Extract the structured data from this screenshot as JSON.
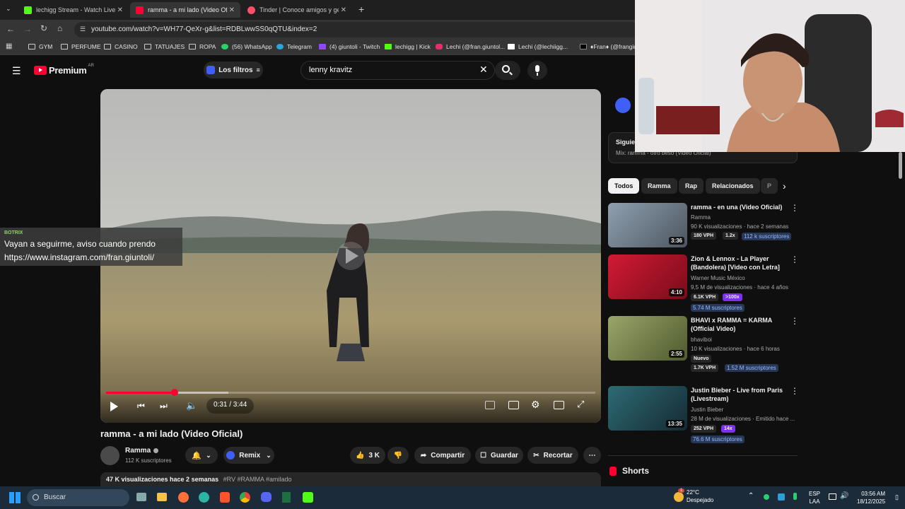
{
  "browser": {
    "tabs": [
      {
        "title": "lechigg Stream - Watch Live on",
        "favicon_color": "#53fc18"
      },
      {
        "title": "ramma - a mi lado (Video Oficial)",
        "favicon_color": "#ff0033"
      },
      {
        "title": "Tinder | Conoce amigos y gente",
        "favicon_color": "#fd5068"
      }
    ],
    "url": "youtube.com/watch?v=WH77-QeXr-g&list=RDBLwwSS0qQTU&index=2",
    "bookmarks": [
      "GYM",
      "PERFUME",
      "CASINO",
      "TATUAJES",
      "ROPA",
      "(56) WhatsApp",
      "Telegram",
      "(4) giuntoli - Twitch",
      "lechigg | Kick",
      "Lechi (@fran.giuntol...",
      "Lechi (@lechiigg...",
      "♦Fran♦ (@frangiu"
    ]
  },
  "youtube": {
    "logo_text": "Premium",
    "region": "AR",
    "filters_label": "Los filtros",
    "search_value": "lenny kravitz"
  },
  "player": {
    "time": "0:31 / 3:44",
    "progress": 0.14,
    "buffered": 0.25
  },
  "overlay": {
    "label": "BOTRIX",
    "line1": "Vayan a seguirme, aviso cuando prendo",
    "line2": "https://www.instagram.com/fran.giuntoli/"
  },
  "video": {
    "title": "ramma - a mi lado (Video Oficial)",
    "channel": "Ramma",
    "subscribers": "112 K suscriptores",
    "remix_label": "Remix",
    "likes": "3 K",
    "share_label": "Compartir",
    "save_label": "Guardar",
    "clip_label": "Recortar",
    "views_line": "47 K visualizaciones  hace 2 semanas",
    "hashtags": "#RV #RAMMA #amilado"
  },
  "sidebar": {
    "next_label": "Siguien",
    "next_sub": "Mix: ramma - otro beso (Video Oficial)",
    "chips": [
      "Todos",
      "Ramma",
      "Rap",
      "Relacionados",
      "P"
    ],
    "recs": [
      {
        "title": "ramma - en una (Video Oficial)",
        "channel": "Ramma",
        "stats": "90 K visualizaciones · hace 2 semanas",
        "vph": "180 VPH",
        "ratio": "1.2x",
        "subs": "112 k suscriptores",
        "duration": "3:36",
        "thumb_color": "#6f7a85"
      },
      {
        "title": "Zion & Lennox - La Player (Bandolera) [Video con Letra]",
        "channel": "Warner Music México",
        "stats": "9,5 M de visualizaciones · hace 4 años",
        "vph": "6.1K VPH",
        "ratio": ">100x",
        "subs": "5.74 M suscriptores",
        "duration": "4:10",
        "thumb_color": "#b3132a"
      },
      {
        "title": "BHAVI x RAMMA = KARMA (Official Video)",
        "channel": "bhaviboi",
        "stats": "10 K visualizaciones · hace 6 horas",
        "badge": "Nuevo",
        "vph": "1.7K VPH",
        "subs": "1.52 M suscriptores",
        "duration": "2:55",
        "thumb_color": "#7b8a4e"
      },
      {
        "title": "Justin Bieber - Live from Paris (Livestream)",
        "channel": "Justin Bieber",
        "stats": "28 M de visualizaciones · Emitido hace ...",
        "vph": "252 VPH",
        "ratio": "14x",
        "subs": "76.6 M suscriptores",
        "duration": "13:35",
        "thumb_color": "#1f4f57"
      }
    ],
    "shorts_label": "Shorts"
  },
  "taskbar": {
    "search_placeholder": "Buscar",
    "weather_temp": "22°C",
    "weather_desc": "Despejado",
    "lang": "ESP",
    "lang2": "LAA",
    "time": "03:56 AM",
    "date": "18/12/2025",
    "notif_count": "1"
  },
  "colors": {
    "yt_red": "#ff0033",
    "accent_blue": "#3ea6ff",
    "vph_purple": "#7b2ff7"
  }
}
